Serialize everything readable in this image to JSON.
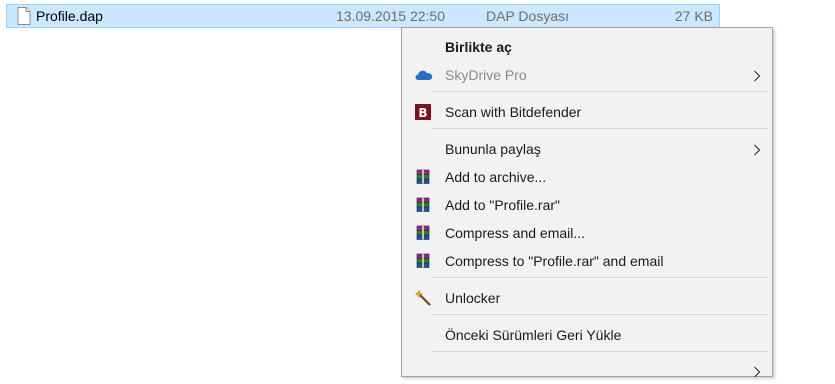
{
  "file": {
    "name": "Profile.dap",
    "date": "13.09.2015 22:50",
    "type": "DAP Dosyası",
    "size": "27 KB",
    "icon": "document-icon"
  },
  "menu": {
    "open_with": "Birlikte aç",
    "skydrive": "SkyDrive Pro",
    "scan": "Scan with Bitdefender",
    "share": "Bununla paylaş",
    "add_archive": "Add to archive...",
    "add_rar": "Add to \"Profile.rar\"",
    "compress_email": "Compress and email...",
    "compress_rar_email": "Compress to \"Profile.rar\" and email",
    "unlocker": "Unlocker",
    "restore": "Önceki Sürümleri Geri Yükle"
  },
  "colors": {
    "selection": "#cce8ff",
    "selection_border": "#99d1ff",
    "menu_background": "#f2f2f2",
    "bitdefender": "#7a1220",
    "onedrive": "#2b6cc4"
  }
}
